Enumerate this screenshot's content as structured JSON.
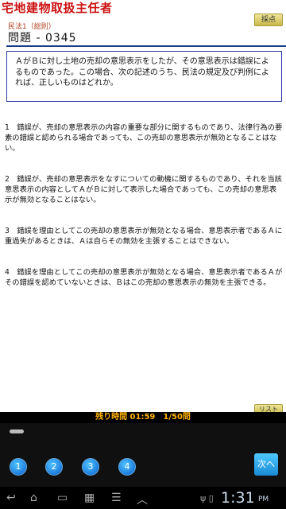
{
  "app": {
    "title": "宅地建物取扱主任者"
  },
  "header": {
    "score_label": "採点"
  },
  "question": {
    "category": "民法1（総則）",
    "number_label": "問題 - 0345",
    "text": "ＡがＢに対し土地の売却の意思表示をしたが、その意思表示は錯誤によるものであった。この場合、次の記述のうち、民法の規定及び判例によれば、正しいものはどれか。"
  },
  "choices": [
    {
      "text": "1　錯誤が、売却の意思表示の内容の重要な部分に関するものであり、法律行為の要素の錯誤と認められる場合であっても、この売却の意思表示が無効となることはない。"
    },
    {
      "text": "2　錯誤が、売却の意思表示をなすについての動機に関するものであり、それを当該意思表示の内容としてＡがＢに対して表示した場合であっても、この売却の意思表示が無効となることはない。"
    },
    {
      "text": "3　錯誤を理由としてこの売却の意思表示が無効となる場合、意思表示者であるＡに重過失があるときは、Ａは自らその無効を主張することはできない。"
    },
    {
      "text": "4　錯誤を理由としてこの売却の意思表示が無効となる場合、意思表示者であるＡがその錯誤を認めていないときは、Ｂはこの売却の意思表示の無効を主張できる。"
    }
  ],
  "footer": {
    "list_label": "リスト",
    "status": "残り時間 01:59　1/50問",
    "answers": [
      "1",
      "2",
      "3",
      "4"
    ],
    "next_label": "次へ"
  },
  "system": {
    "time": "1:31",
    "ampm": "PM"
  }
}
